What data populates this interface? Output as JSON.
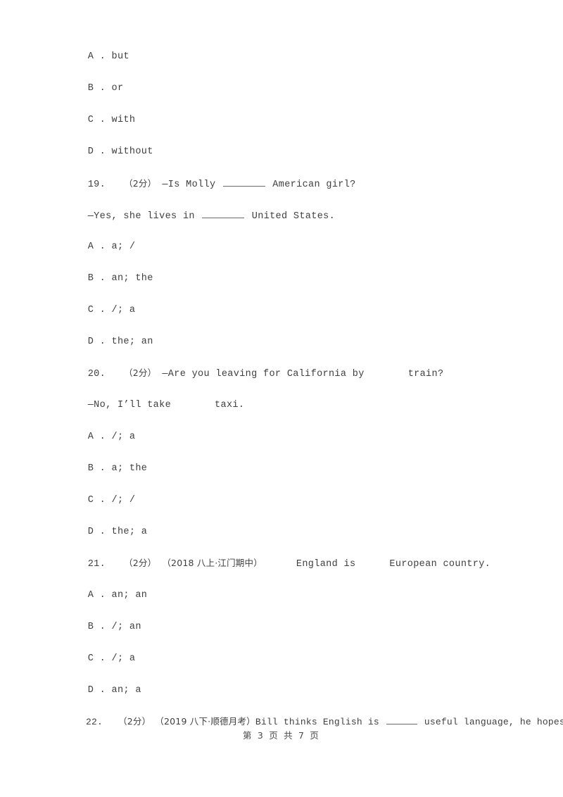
{
  "document": {
    "page_label": "第 3 页 共 7 页",
    "page_number": "3",
    "total_pages": "7"
  },
  "carryover_options": {
    "note": "options continuing from question 18 on the previous page",
    "items": [
      {
        "letter": "A",
        "sep": " . ",
        "text": "but"
      },
      {
        "letter": "B",
        "sep": " . ",
        "text": "or"
      },
      {
        "letter": "C",
        "sep": " . ",
        "text": "with"
      },
      {
        "letter": "D",
        "sep": " . ",
        "text": "without"
      }
    ]
  },
  "questions": [
    {
      "number": "19.",
      "points": "（2分）",
      "source": "",
      "stem_line1_before": "—Is Molly ",
      "stem_line1_after": " American girl?",
      "stem_line2_before": "—Yes, she lives in ",
      "stem_line2_after": " United States.",
      "options": [
        {
          "letter": "A",
          "sep": " . ",
          "text": "a; /"
        },
        {
          "letter": "B",
          "sep": " . ",
          "text": "an; the"
        },
        {
          "letter": "C",
          "sep": " . ",
          "text": "/; a"
        },
        {
          "letter": "D",
          "sep": " . ",
          "text": "the; an"
        }
      ]
    },
    {
      "number": "20.",
      "points": "（2分）",
      "source": "",
      "stem_line1_before": "—Are you leaving for California by",
      "stem_line1_after": "train?",
      "stem_line2_before": "—No, I’ll take",
      "stem_line2_after": "taxi.",
      "options": [
        {
          "letter": "A",
          "sep": " . ",
          "text": "/; a"
        },
        {
          "letter": "B",
          "sep": " . ",
          "text": "a; the"
        },
        {
          "letter": "C",
          "sep": " . ",
          "text": "/; /"
        },
        {
          "letter": "D",
          "sep": " . ",
          "text": "the; a"
        }
      ]
    },
    {
      "number": "21.",
      "points": "（2分）",
      "source": "（2018 八上·江门期中）",
      "stem_line1_before": "England is",
      "stem_line1_after": "European country.",
      "options": [
        {
          "letter": "A",
          "sep": " . ",
          "text": "an; an"
        },
        {
          "letter": "B",
          "sep": " . ",
          "text": "/; an"
        },
        {
          "letter": "C",
          "sep": " . ",
          "text": "/; a"
        },
        {
          "letter": "D",
          "sep": " . ",
          "text": "an; a"
        }
      ]
    },
    {
      "number": "22.",
      "points": "（2分）",
      "source": "（2019 八下·顺德月考）",
      "stem_line1_before": "Bill thinks English is ",
      "stem_line1_after": " useful language, he hopes to"
    }
  ]
}
